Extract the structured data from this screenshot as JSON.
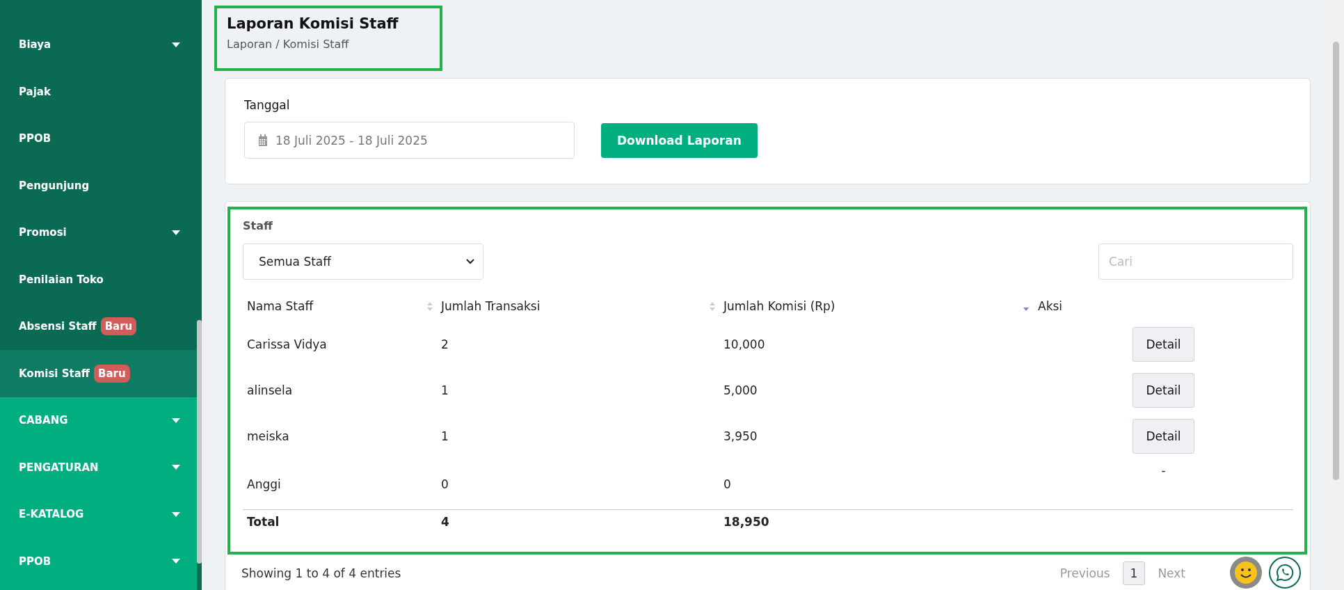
{
  "sidebar": {
    "items": [
      {
        "label": "Biaya",
        "kind": "sub",
        "caret": true,
        "selected": false
      },
      {
        "label": "Pajak",
        "kind": "sub",
        "caret": false,
        "selected": false
      },
      {
        "label": "PPOB",
        "kind": "sub",
        "caret": false,
        "selected": false
      },
      {
        "label": "Pengunjung",
        "kind": "sub",
        "caret": false,
        "selected": false
      },
      {
        "label": "Promosi",
        "kind": "sub",
        "caret": true,
        "selected": false
      },
      {
        "label": "Penilaian Toko",
        "kind": "sub",
        "caret": false,
        "selected": false
      },
      {
        "label": "Absensi Staff",
        "kind": "sub",
        "caret": false,
        "selected": false,
        "badge": "Baru"
      },
      {
        "label": "Komisi Staff",
        "kind": "sub",
        "caret": false,
        "selected": true,
        "badge": "Baru"
      },
      {
        "label": "CABANG",
        "kind": "section",
        "caret": true,
        "selected": false
      },
      {
        "label": "PENGATURAN",
        "kind": "section",
        "caret": true,
        "selected": false
      },
      {
        "label": "E-KATALOG",
        "kind": "section",
        "caret": true,
        "selected": false
      },
      {
        "label": "PPOB",
        "kind": "section",
        "caret": true,
        "selected": false
      }
    ]
  },
  "header": {
    "title": "Laporan Komisi Staff",
    "breadcrumb": "Laporan / Komisi Staff",
    "highlighted": true
  },
  "filter": {
    "label": "Tanggal",
    "date_range": "18 Juli 2025 - 18 Juli 2025",
    "button": "Download Laporan"
  },
  "staff_table": {
    "highlighted": true,
    "label": "Staff",
    "staff_select": "Semua Staff",
    "search": {
      "placeholder": "Cari"
    },
    "columns": [
      {
        "label": "Nama Staff",
        "sortable": true,
        "sorted_desc": false
      },
      {
        "label": "Jumlah Transaksi",
        "sortable": true,
        "sorted_desc": false
      },
      {
        "label": "Jumlah Komisi (Rp)",
        "sortable": true,
        "sorted_desc": true
      },
      {
        "label": "Aksi",
        "sortable": false
      }
    ],
    "rows": [
      {
        "name": "Carissa Vidya",
        "transactions": "2",
        "commission": "10,000",
        "action": {
          "kind": "button",
          "label": "Detail"
        }
      },
      {
        "name": "alinsela",
        "transactions": "1",
        "commission": "5,000",
        "action": {
          "kind": "button",
          "label": "Detail"
        }
      },
      {
        "name": "meiska",
        "transactions": "1",
        "commission": "3,950",
        "action": {
          "kind": "button",
          "label": "Detail"
        }
      },
      {
        "name": "Anggi",
        "transactions": "0",
        "commission": "0",
        "action": {
          "kind": "text",
          "label": "-"
        }
      }
    ],
    "total": {
      "label": "Total",
      "transactions": "4",
      "commission": "18,950"
    },
    "pagination": {
      "info": "Showing 1 to 4 of 4 entries",
      "previous": {
        "label": "Previous",
        "disabled": true
      },
      "pages": [
        {
          "label": "1",
          "selected": true
        }
      ],
      "next": {
        "label": "Next",
        "disabled": true
      }
    }
  }
}
